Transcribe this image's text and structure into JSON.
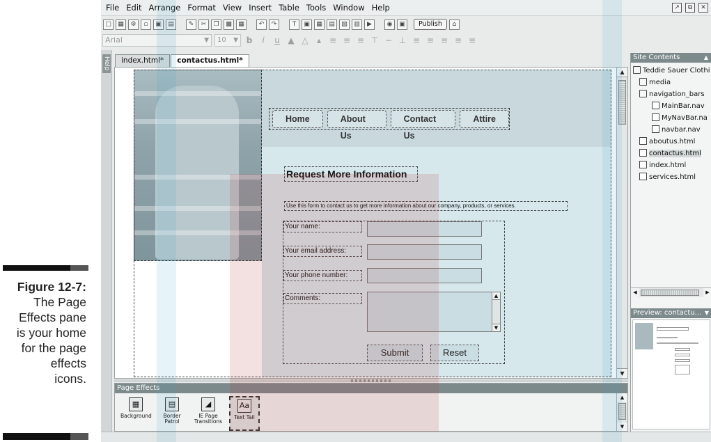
{
  "caption": {
    "figure_label": "Figure 12-7:",
    "line1": "The Page",
    "line2": "Effects pane",
    "line3": "is your home",
    "line4": "for the page",
    "line5": "effects",
    "line6": "icons."
  },
  "menubar": {
    "items": [
      "File",
      "Edit",
      "Arrange",
      "Format",
      "View",
      "Insert",
      "Table",
      "Tools",
      "Window",
      "Help"
    ]
  },
  "toolbar": {
    "publish_label": "Publish"
  },
  "format_toolbar": {
    "font_value": "Arial",
    "size_value": "10"
  },
  "help_strip": {
    "label": "Help"
  },
  "doc_tabs": [
    "index.html*",
    "contactus.html*"
  ],
  "page": {
    "nav_buttons": [
      "Home",
      "About Us",
      "Contact Us",
      "Attire"
    ],
    "title": "Request More Information",
    "intro": "Use this form to contact us to get more information about our company, products, or services.",
    "form": {
      "name_label": "Your name:",
      "email_label": "Your email address:",
      "phone_label": "Your phone number:",
      "comments_label": "Comments:",
      "submit_label": "Submit",
      "reset_label": "Reset"
    }
  },
  "page_effects": {
    "title": "Page Effects",
    "items": [
      {
        "line1": "Background",
        "line2": ""
      },
      {
        "line1": "Border",
        "line2": "Patrol"
      },
      {
        "line1": "IE Page",
        "line2": "Transitions"
      },
      {
        "line1": "Text Tail",
        "line2": ""
      }
    ]
  },
  "site_contents": {
    "title": "Site Contents",
    "tree": [
      {
        "label": "Teddie Sauer Clothi",
        "indent": 0,
        "type": "folder"
      },
      {
        "label": "media",
        "indent": 1,
        "type": "folder"
      },
      {
        "label": "navigation_bars",
        "indent": 1,
        "type": "folder"
      },
      {
        "label": "MainBar.nav",
        "indent": 3,
        "type": "nav"
      },
      {
        "label": "MyNavBar.na",
        "indent": 3,
        "type": "nav"
      },
      {
        "label": "navbar.nav",
        "indent": 3,
        "type": "nav"
      },
      {
        "label": "aboutus.html",
        "indent": 1,
        "type": "file"
      },
      {
        "label": "contactus.html",
        "indent": 1,
        "type": "file"
      },
      {
        "label": "index.html",
        "indent": 1,
        "type": "file"
      },
      {
        "label": "services.html",
        "indent": 1,
        "type": "file"
      }
    ],
    "selected": "contactus.html"
  },
  "preview": {
    "title": "Preview: contactu..."
  }
}
